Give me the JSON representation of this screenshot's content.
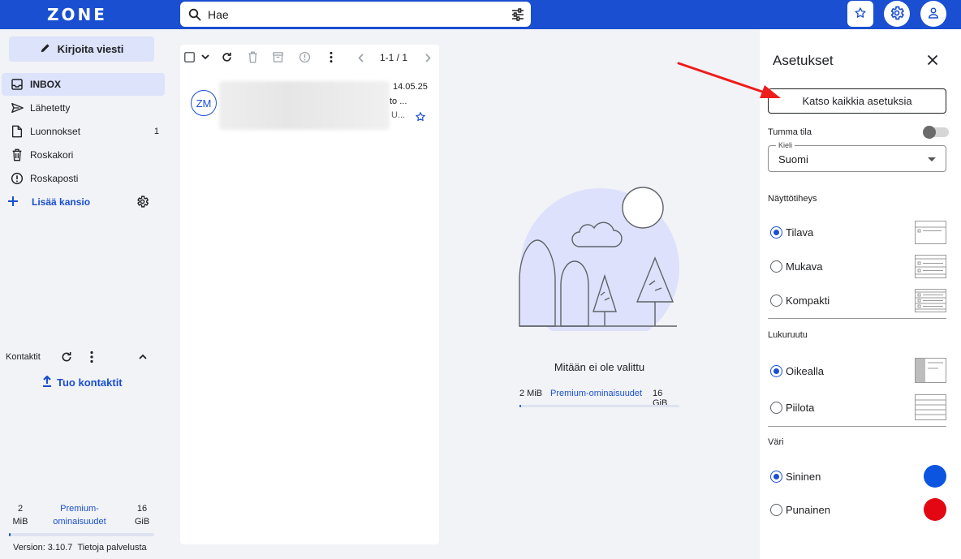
{
  "app": {
    "logo": "ZONE"
  },
  "search": {
    "placeholder": "Hae"
  },
  "sidebar": {
    "compose_label": "Kirjoita viesti",
    "folders": [
      {
        "label": "INBOX",
        "icon": "inbox-icon",
        "count": ""
      },
      {
        "label": "Lähetetty",
        "icon": "send-icon",
        "count": ""
      },
      {
        "label": "Luonnokset",
        "icon": "draft-icon",
        "count": "1"
      },
      {
        "label": "Roskakori",
        "icon": "trash-icon",
        "count": ""
      },
      {
        "label": "Roskaposti",
        "icon": "spam-icon",
        "count": ""
      }
    ],
    "add_folder_label": "Lisää kansio",
    "contacts_label": "Kontaktit",
    "import_label": "Tuo kontaktit",
    "storage": {
      "used_value": "2",
      "used_unit": "MiB",
      "premium_line1": "Premium-",
      "premium_line2": "ominaisuudet",
      "total_value": "16",
      "total_unit": "GiB"
    },
    "version_text": "Version: 3.10.7",
    "about_link": "Tietoja palvelusta"
  },
  "mail_list": {
    "pager_text": "1-1 / 1",
    "items": [
      {
        "avatar_initials": "ZM",
        "date": "14.05.25",
        "subject_preview": "to ...",
        "body_preview": "U..."
      }
    ]
  },
  "reading_pane": {
    "empty_text": "Mitään ei ole valittu",
    "storage_used": "2 MiB",
    "premium_label": "Premium-ominaisuudet",
    "storage_total": "16 GiB"
  },
  "settings": {
    "title": "Asetukset",
    "view_all_label": "Katso kaikkia asetuksia",
    "dark_mode_label": "Tumma tila",
    "dark_mode_on": false,
    "language_legend": "Kieli",
    "language_value": "Suomi",
    "density_label": "Näyttötiheys",
    "density_options": [
      "Tilava",
      "Mukava",
      "Kompakti"
    ],
    "density_selected": "Tilava",
    "reading_pane_label": "Lukuruutu",
    "reading_pane_options": [
      "Oikealla",
      "Piilota"
    ],
    "reading_pane_selected": "Oikealla",
    "color_label": "Väri",
    "color_options": [
      "Sininen",
      "Punainen"
    ],
    "color_selected": "Sininen",
    "colors": {
      "blue": "#0b55e0",
      "red": "#e30613"
    }
  },
  "colors": {
    "accent": "#1a4fd1",
    "annotation_arrow": "#ee1c1c"
  }
}
